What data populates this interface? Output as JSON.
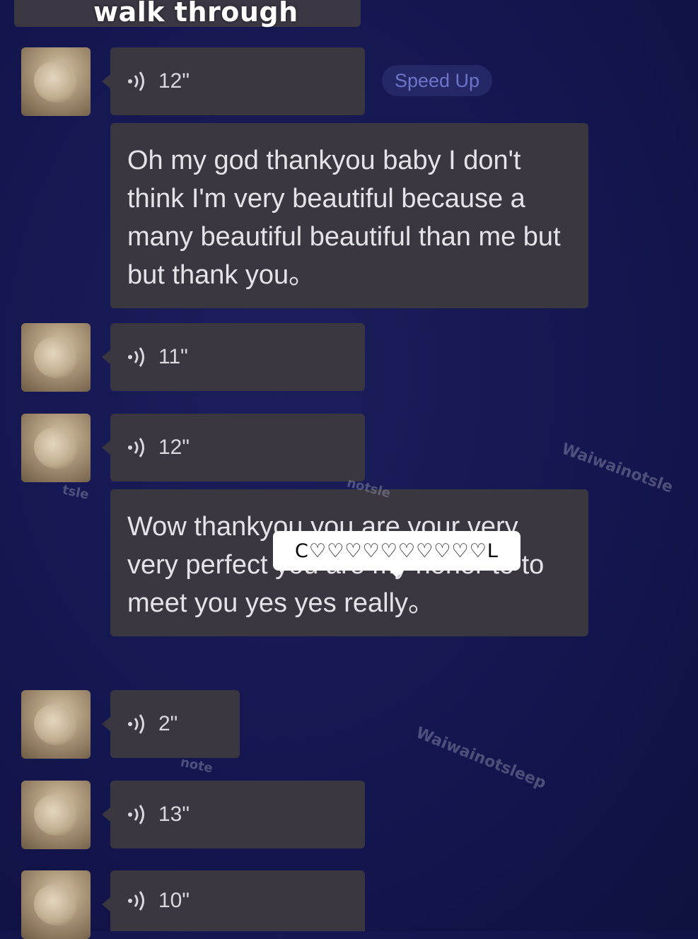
{
  "caption": "walk through",
  "speed_up_label": "Speed Up",
  "messages": [
    {
      "kind": "voice",
      "duration": "12\""
    },
    {
      "kind": "text",
      "text": "Oh my god thankyou baby I don't think I'm very beautiful because a many beautiful beautiful than me but but thank you。"
    },
    {
      "kind": "voice",
      "duration": "11\""
    },
    {
      "kind": "voice",
      "duration": "12\""
    },
    {
      "kind": "text",
      "text": "Wow thankyou you are your very very perfect you are my honor to to meet you yes yes really。"
    },
    {
      "kind": "voice",
      "duration": "2\""
    },
    {
      "kind": "voice",
      "duration": "13\""
    },
    {
      "kind": "voice",
      "duration": "10\""
    }
  ],
  "popup_text": "C♡♡♡♡♡♡♡♡♡♡L",
  "watermarks": [
    "Waiwainotsle",
    "Waiwainotsleep",
    "notsle",
    "note",
    "tsle"
  ],
  "icons": {
    "voice": "voice-wave-icon",
    "avatar": "avatar-image"
  }
}
